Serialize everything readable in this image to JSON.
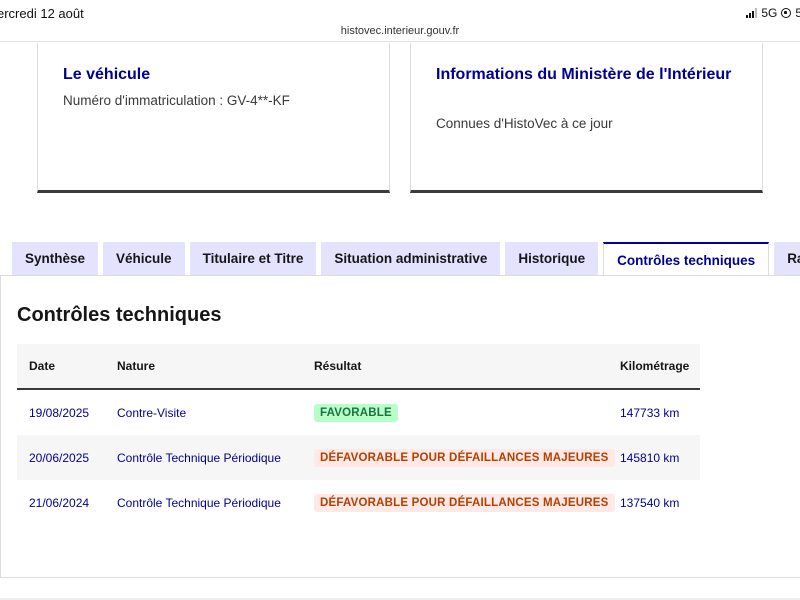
{
  "status_bar": {
    "time": "ercredi 12 août",
    "network": "5G",
    "extra": "5("
  },
  "browser": {
    "url": "histovec.interieur.gouv.fr"
  },
  "cards": [
    {
      "title": "Le véhicule",
      "subtitle": "Numéro d'immatriculation : GV-4**-KF"
    },
    {
      "title": "Informations du Ministère de l'Intérieur",
      "subtitle": "Connues d'HistoVec à ce jour"
    }
  ],
  "tabs": [
    {
      "label": "Synthèse"
    },
    {
      "label": "Véhicule"
    },
    {
      "label": "Titulaire et Titre"
    },
    {
      "label": "Situation administrative"
    },
    {
      "label": "Historique"
    },
    {
      "label": "Contrôles techniques"
    },
    {
      "label": "Rap"
    }
  ],
  "panel": {
    "title": "Contrôles techniques",
    "columns": [
      "Date",
      "Nature",
      "Résultat",
      "Kilométrage"
    ],
    "rows": [
      {
        "date": "19/08/2025",
        "nature": "Contre-Visite",
        "result": "FAVORABLE",
        "km": "147733 km"
      },
      {
        "date": "20/06/2025",
        "nature": "Contrôle Technique Périodique",
        "result": "DÉFAVORABLE POUR DÉFAILLANCES MAJEURES",
        "km": "145810 km"
      },
      {
        "date": "21/06/2024",
        "nature": "Contrôle Technique Périodique",
        "result": "DÉFAVORABLE POUR DÉFAILLANCES MAJEURES",
        "km": "137540 km"
      }
    ]
  },
  "colors": {
    "primary": "#000091",
    "tab_bg": "#e3e3fd",
    "success_bg": "#b8fec9",
    "success_text": "#18753c",
    "error_bg": "#ffe9e6",
    "error_text": "#b34000"
  }
}
